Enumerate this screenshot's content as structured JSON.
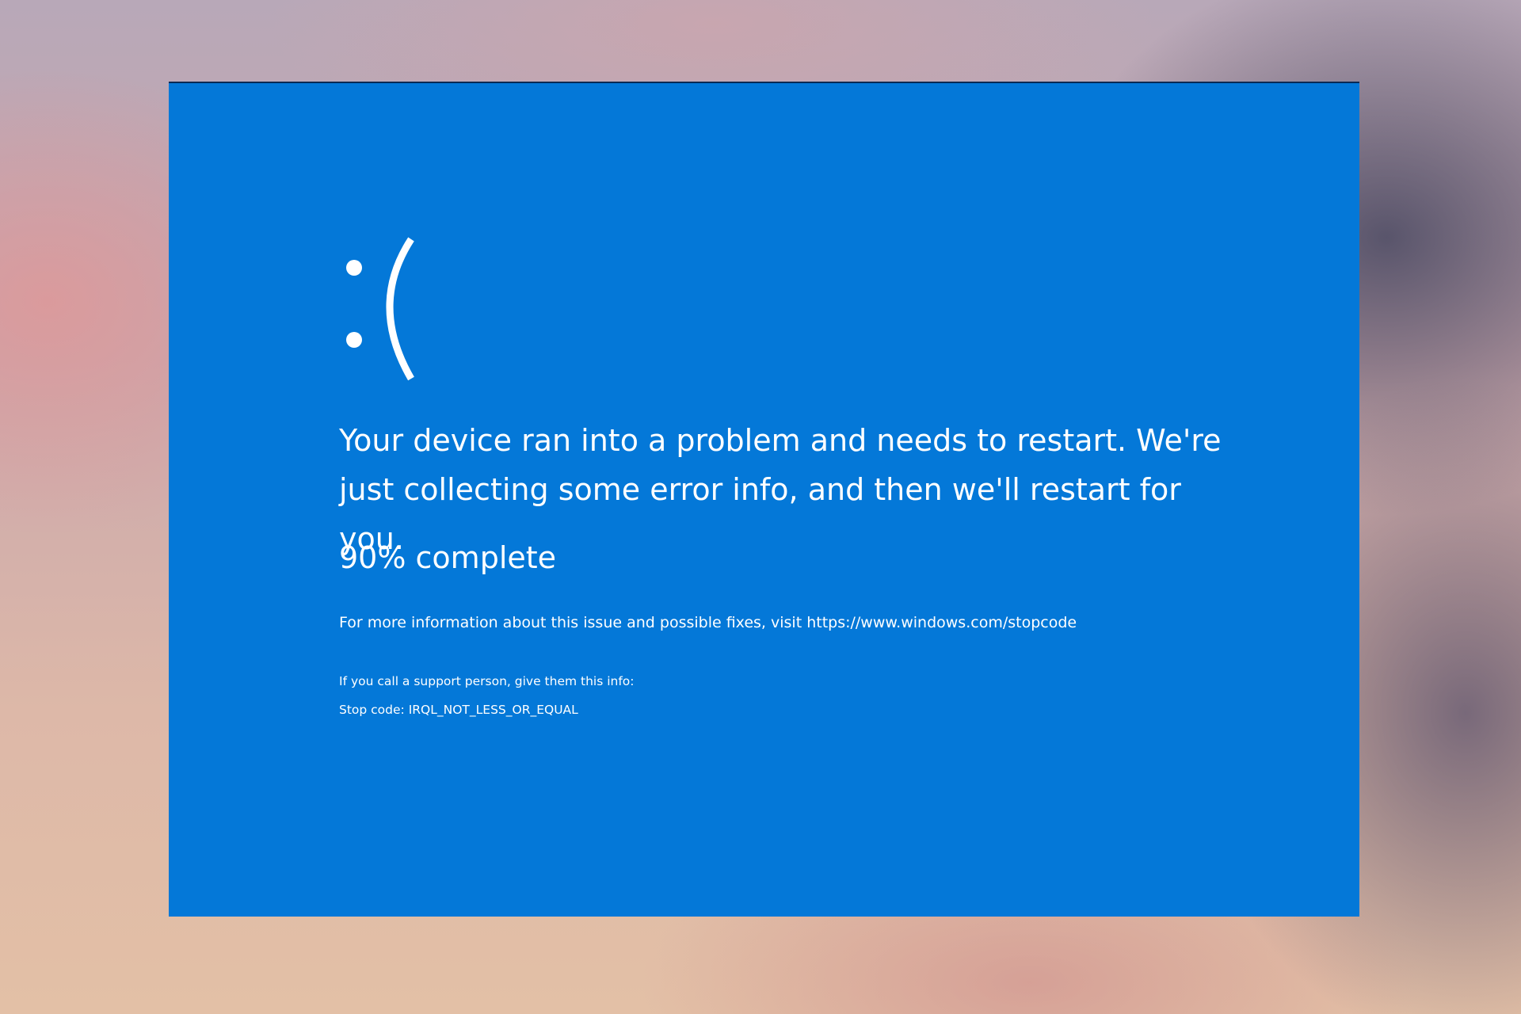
{
  "screen": {
    "background_color": "#0478d8",
    "text_color": "#ffffff",
    "face": ":(",
    "message": "Your device ran into a problem and needs to restart. We're just collecting some error info, and then we'll restart for you.",
    "progress_text": "90% complete",
    "progress_percent": 90,
    "info_prefix": "For more information about this issue and possible fixes, visit ",
    "info_link": "https://www.windows.com/stopcode",
    "support_text": "If you call a support person, give them this info:",
    "stop_code_label": "Stop code: ",
    "stop_code": "IRQL_NOT_LESS_OR_EQUAL"
  }
}
